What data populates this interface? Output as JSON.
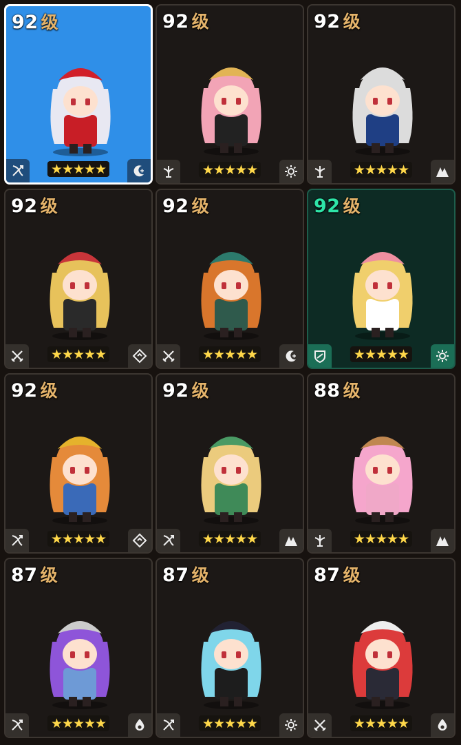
{
  "level_unit": "级",
  "heroes": [
    {
      "level": "92",
      "stars": "★★★★★",
      "role_icon": "bow-icon",
      "elem_icon": "moon-icon",
      "selected": true,
      "highlight": false,
      "portrait": {
        "hair": "#e8e8f2",
        "hat": "#d1202a",
        "outfit": "#c81e26"
      }
    },
    {
      "level": "92",
      "stars": "★★★★★",
      "role_icon": "healer-icon",
      "elem_icon": "gear-icon",
      "selected": false,
      "highlight": false,
      "portrait": {
        "hair": "#f2a4b6",
        "hat": "#e2b455",
        "outfit": "#222222"
      }
    },
    {
      "level": "92",
      "stars": "★★★★★",
      "role_icon": "healer-icon",
      "elem_icon": "mountain-icon",
      "selected": false,
      "highlight": false,
      "portrait": {
        "hair": "#dcdcdc",
        "hat": "#dcdcdc",
        "outfit": "#1f3f84"
      }
    },
    {
      "level": "92",
      "stars": "★★★★★",
      "role_icon": "swords-icon",
      "elem_icon": "diamond-icon",
      "selected": false,
      "highlight": false,
      "portrait": {
        "hair": "#e7c25b",
        "hat": "#c8353a",
        "outfit": "#2a2a2a"
      }
    },
    {
      "level": "92",
      "stars": "★★★★★",
      "role_icon": "swords-icon",
      "elem_icon": "moon-icon",
      "selected": false,
      "highlight": false,
      "portrait": {
        "hair": "#d9762c",
        "hat": "#2c7a6c",
        "outfit": "#2f5a4c"
      }
    },
    {
      "level": "92",
      "stars": "★★★★★",
      "role_icon": "shield-icon",
      "elem_icon": "gear-icon",
      "selected": false,
      "highlight": true,
      "portrait": {
        "hair": "#f0cf6c",
        "hat": "#ee8fa0",
        "outfit": "#ffffff"
      }
    },
    {
      "level": "92",
      "stars": "★★★★★",
      "role_icon": "bow-icon",
      "elem_icon": "diamond-icon",
      "selected": false,
      "highlight": false,
      "portrait": {
        "hair": "#e58a3a",
        "hat": "#e5b22c",
        "outfit": "#3a6ab8"
      }
    },
    {
      "level": "92",
      "stars": "★★★★★",
      "role_icon": "bow-icon",
      "elem_icon": "mountain-icon",
      "selected": false,
      "highlight": false,
      "portrait": {
        "hair": "#ebcb7d",
        "hat": "#4a9a64",
        "outfit": "#3f8a58"
      }
    },
    {
      "level": "88",
      "stars": "★★★★★",
      "role_icon": "healer-icon",
      "elem_icon": "mountain-icon",
      "selected": false,
      "highlight": false,
      "portrait": {
        "hair": "#f5a6cc",
        "hat": "#c08750",
        "outfit": "#f0a8c8"
      }
    },
    {
      "level": "87",
      "stars": "★★★★★",
      "role_icon": "bow-icon",
      "elem_icon": "water-icon",
      "selected": false,
      "highlight": false,
      "portrait": {
        "hair": "#8e55d9",
        "hat": "#cccccc",
        "outfit": "#6e9ad6"
      }
    },
    {
      "level": "87",
      "stars": "★★★★★",
      "role_icon": "bow-icon",
      "elem_icon": "gear-icon",
      "selected": false,
      "highlight": false,
      "portrait": {
        "hair": "#7fd6ea",
        "hat": "#222233",
        "outfit": "#1d1d1d"
      }
    },
    {
      "level": "87",
      "stars": "★★★★★",
      "role_icon": "swords-icon",
      "elem_icon": "water-icon",
      "selected": false,
      "highlight": false,
      "portrait": {
        "hair": "#dc3b3b",
        "hat": "#eeeeee",
        "outfit": "#2a2a36"
      }
    }
  ]
}
